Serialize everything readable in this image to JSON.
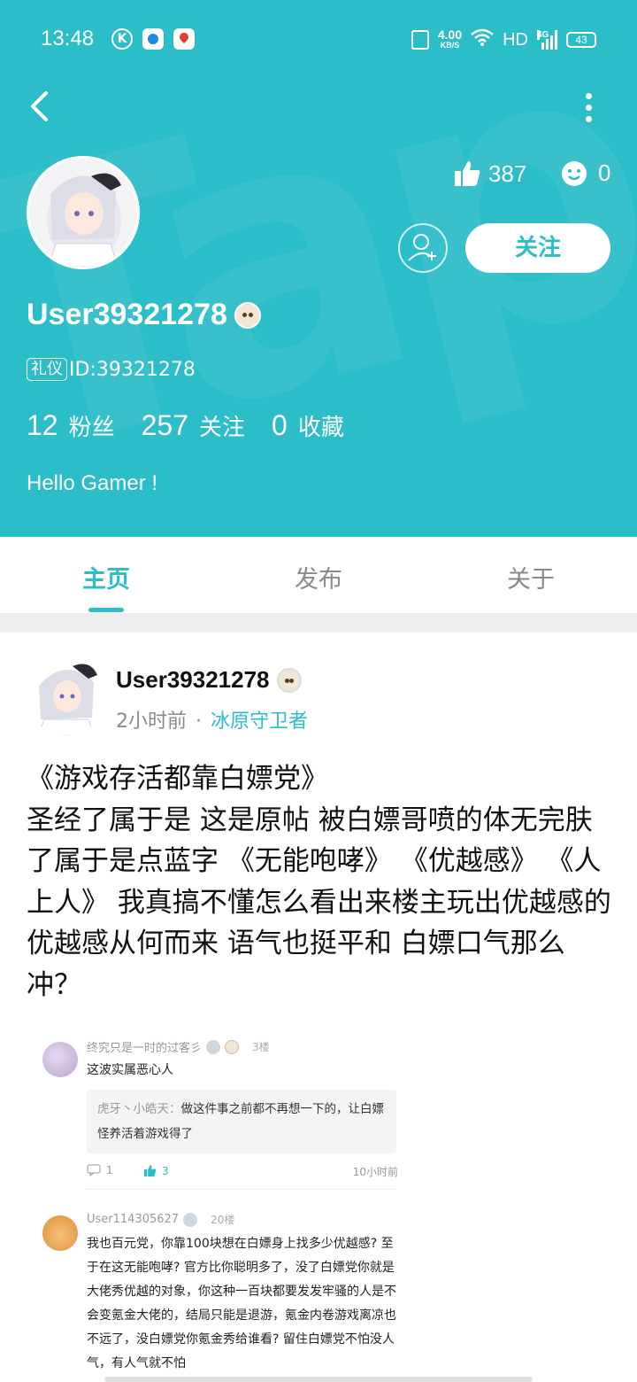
{
  "status_bar": {
    "time": "13:48",
    "apps": [
      "k-app-icon",
      "circle-app-icon",
      "map-app-icon"
    ],
    "net_speed": "4.00",
    "net_unit": "KB/S",
    "hd": "HD",
    "network": "4G",
    "battery": "43"
  },
  "colors": {
    "accent": "#2bbdc8",
    "header_bg": "#2bbdc8",
    "text_dark": "#111111",
    "muted": "#8a8a8a"
  },
  "profile": {
    "username": "User39321278",
    "id_tag": "礼仪",
    "id_text": "ID:39321278",
    "likes": "387",
    "emoji_count": "0",
    "follow_label": "关注",
    "counts": [
      {
        "num": "12",
        "label": "粉丝"
      },
      {
        "num": "257",
        "label": "关注"
      },
      {
        "num": "0",
        "label": "收藏"
      }
    ],
    "bio": "Hello Gamer !"
  },
  "tabs": [
    {
      "label": "主页",
      "active": true
    },
    {
      "label": "发布",
      "active": false
    },
    {
      "label": "关于",
      "active": false
    }
  ],
  "post": {
    "author": "User39321278",
    "time": "2小时前",
    "separator": "·",
    "forum": "冰原守卫者",
    "body": "《游戏存活都靠白嫖党》\n圣经了属于是 这是原帖 被白嫖哥喷的体无完肤了属于是点蓝字 《无能咆哮》 《优越感》 《人上人》 我真搞不懂怎么看出来楼主玩出优越感的 优越感从何而来 语气也挺平和 白嫖口气那么冲？"
  },
  "comments": [
    {
      "user": "终究只是一时的过客彡",
      "floor": "3楼",
      "text": "这波实属恶心人",
      "quote_name": "虎牙丶小皓天：",
      "quote_text": "做这件事之前都不再想一下的，让白嫖怪养活着游戏得了",
      "reply_count": "1",
      "likes": "3",
      "time": "10小时前"
    },
    {
      "user": "User114305627",
      "floor": "20楼",
      "text": "我也百元党，你靠100块想在白嫖身上找多少优越感? 至于在这无能咆哮? 官方比你聪明多了，没了白嫖党你就是大佬秀优越的对象，你这种一百块都要发发牢骚的人是不会变氪金大佬的，结局只能是退游，氪金内卷游戏离凉也不远了，没白嫖党你氪金秀给谁看? 留住白嫖党不怕没人气，有人气就不怕"
    }
  ]
}
